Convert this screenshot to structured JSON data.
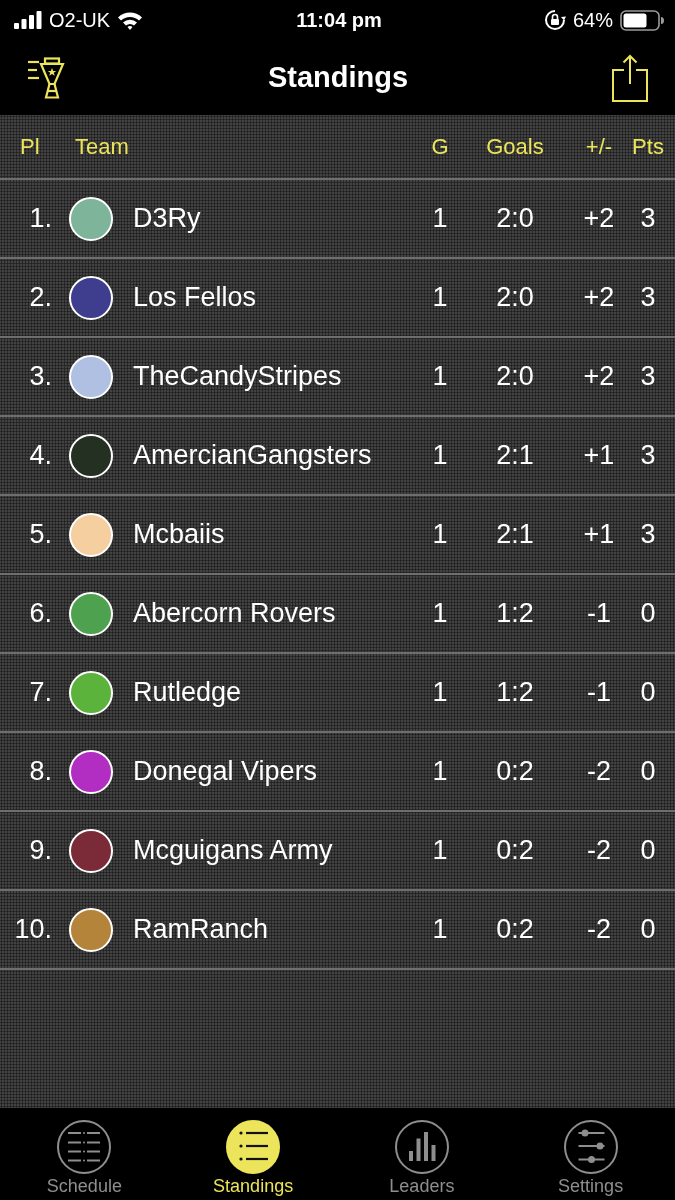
{
  "status_bar": {
    "carrier": "O2-UK",
    "time": "11:04 pm",
    "battery": "64%"
  },
  "nav_bar": {
    "title": "Standings"
  },
  "table": {
    "columns": [
      "Pl",
      "Team",
      "G",
      "Goals",
      "+/-",
      "Pts"
    ],
    "rows": [
      {
        "rank": "1.",
        "color": "#7db49a",
        "team": "D3Ry",
        "games": "1",
        "goals": "2:0",
        "difference": "+2",
        "points": "3"
      },
      {
        "rank": "2.",
        "color": "#3f3e8e",
        "team": "Los Fellos",
        "games": "1",
        "goals": "2:0",
        "difference": "+2",
        "points": "3"
      },
      {
        "rank": "3.",
        "color": "#b0c0e2",
        "team": "TheCandyStripes",
        "games": "1",
        "goals": "2:0",
        "difference": "+2",
        "points": "3"
      },
      {
        "rank": "4.",
        "color": "#243022",
        "team": "AmercianGangsters",
        "games": "1",
        "goals": "2:1",
        "difference": "+1",
        "points": "3"
      },
      {
        "rank": "5.",
        "color": "#f5cfa0",
        "team": "Mcbaiis",
        "games": "1",
        "goals": "2:1",
        "difference": "+1",
        "points": "3"
      },
      {
        "rank": "6.",
        "color": "#4ea24f",
        "team": "Abercorn Rovers",
        "games": "1",
        "goals": "1:2",
        "difference": "-1",
        "points": "0"
      },
      {
        "rank": "7.",
        "color": "#5cb33c",
        "team": "Rutledge",
        "games": "1",
        "goals": "1:2",
        "difference": "-1",
        "points": "0"
      },
      {
        "rank": "8.",
        "color": "#b22dc1",
        "team": "Donegal Vipers",
        "games": "1",
        "goals": "0:2",
        "difference": "-2",
        "points": "0"
      },
      {
        "rank": "9.",
        "color": "#7b2b38",
        "team": "Mcguigans Army",
        "games": "1",
        "goals": "0:2",
        "difference": "-2",
        "points": "0"
      },
      {
        "rank": "10.",
        "color": "#b4843b",
        "team": "RamRanch",
        "games": "1",
        "goals": "0:2",
        "difference": "-2",
        "points": "0"
      }
    ]
  },
  "tab_bar": [
    {
      "label": "Schedule",
      "selected": false
    },
    {
      "label": "Standings",
      "selected": true
    },
    {
      "label": "Leaders",
      "selected": false
    },
    {
      "label": "Settings",
      "selected": false
    }
  ]
}
